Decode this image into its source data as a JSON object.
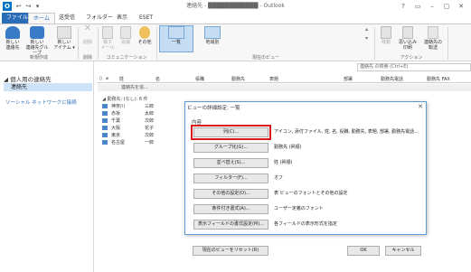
{
  "title_bar": {
    "app_icon": "O",
    "quick_access": [
      "↩",
      "↪",
      "▾"
    ],
    "title": "連絡先 - ████████████ - Outlook",
    "window_buttons": [
      "?",
      "▭",
      "–",
      "▢",
      "✕"
    ]
  },
  "tabs": [
    "ファイル",
    "ホーム",
    "送受信",
    "フォルダー",
    "表示",
    "ESET"
  ],
  "ribbon": {
    "groups": {
      "new": "新規作成",
      "delete": "削除",
      "communication": "コミュニケーション",
      "current_view": "現在のビュー",
      "actions": "アクション"
    },
    "buttons": {
      "new_contact": "新しい\n連絡先",
      "new_group": "新しい\n連絡先グループ",
      "new_items": "新しい\nアイテム ▾",
      "delete": "削除",
      "email": "電子\nメール",
      "meeting": "会議",
      "other": "その他",
      "list_view": "一覧",
      "region_view": "地域別",
      "move": "移動",
      "print": "思い込み\n印刷",
      "forward": "連絡先の\n転送"
    }
  },
  "search": {
    "placeholder": "連絡先 の検索 (Ctrl+E)"
  },
  "left_pane": {
    "heading": "個人用の連絡先",
    "folder": "連絡先",
    "social_link": "ソーシャル ネットワークに接続"
  },
  "list": {
    "columns": [
      "姓",
      "名",
      "役職",
      "勤務先",
      "表題",
      "部署",
      "勤務先電話",
      "勤務先 FAX"
    ],
    "new_row_placeholder": "連絡先を追...",
    "group_header": "勤務先: (なし): 6 件",
    "rows": [
      {
        "last": "神奈川",
        "first": "三郎"
      },
      {
        "last": "赤坂",
        "first": "太郎"
      },
      {
        "last": "千葉",
        "first": "次郎"
      },
      {
        "last": "大阪",
        "first": "花子"
      },
      {
        "last": "東京",
        "first": "次郎"
      },
      {
        "last": "名古屋",
        "first": "一郎"
      }
    ]
  },
  "dialog": {
    "title": "ビューの詳細設定: 一覧",
    "section": "内容",
    "rows": [
      {
        "button": "列(C)...",
        "value": "アイコン, 添付ファイル, 姓, 名, 役職, 勤務先, 表題, 部署, 勤務先電話..."
      },
      {
        "button": "グループ化(G)...",
        "value": "勤務先 (昇順)"
      },
      {
        "button": "並べ替え(S)...",
        "value": "姓 (昇順)"
      },
      {
        "button": "フィルター(F)...",
        "value": "オフ"
      },
      {
        "button": "その他の設定(O)...",
        "value": "表 ビューのフォントとその他の設定"
      },
      {
        "button": "条件付き書式(A)...",
        "value": "ユーザー定義のフォント"
      },
      {
        "button": "表示フィールドの書式設定(M)...",
        "value": "各フィールドの表示形式を指定"
      }
    ],
    "reset_button": "現在のビューをリセット(R)",
    "ok_button": "OK",
    "cancel_button": "キャンセル"
  },
  "colors": {
    "accent": "#2b6cb7",
    "highlight": "#e0161b"
  }
}
